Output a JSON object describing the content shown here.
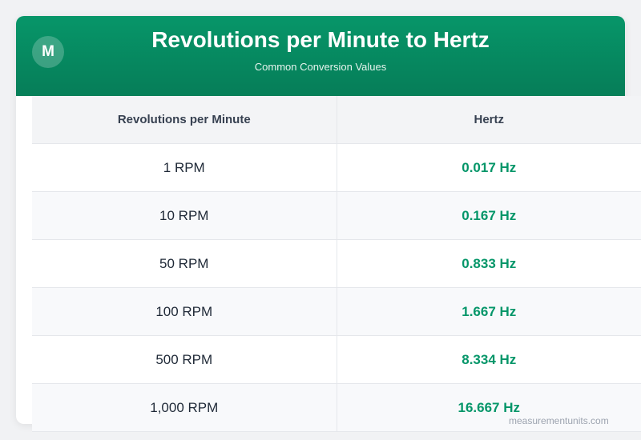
{
  "header": {
    "logo": "M",
    "title": "Revolutions per Minute to Hertz",
    "subtitle": "Common Conversion Values"
  },
  "table": {
    "columns": [
      "Revolutions per Minute",
      "Hertz"
    ],
    "rows": [
      {
        "rpm": "1 RPM",
        "hz": "0.017 Hz"
      },
      {
        "rpm": "10 RPM",
        "hz": "0.167 Hz"
      },
      {
        "rpm": "50 RPM",
        "hz": "0.833 Hz"
      },
      {
        "rpm": "100 RPM",
        "hz": "1.667 Hz"
      },
      {
        "rpm": "500 RPM",
        "hz": "8.334 Hz"
      },
      {
        "rpm": "1,000 RPM",
        "hz": "16.667 Hz"
      }
    ]
  },
  "watermark": "measurementunits.com",
  "colors": {
    "brand": "#059669",
    "header_dark": "#067d58"
  }
}
